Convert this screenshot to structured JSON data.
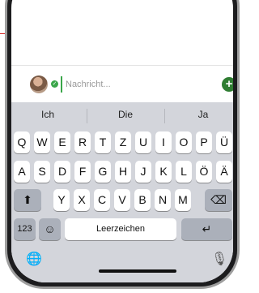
{
  "compose": {
    "placeholder": "Nachricht...",
    "add_button": "+",
    "verified_mark": "✓"
  },
  "keyboard": {
    "suggestions": [
      "Ich",
      "Die",
      "Ja"
    ],
    "row1": [
      "Q",
      "W",
      "E",
      "R",
      "T",
      "Z",
      "U",
      "I",
      "O",
      "P",
      "Ü"
    ],
    "row2": [
      "A",
      "S",
      "D",
      "F",
      "G",
      "H",
      "J",
      "K",
      "L",
      "Ö",
      "Ä"
    ],
    "row3": [
      "Y",
      "X",
      "C",
      "V",
      "B",
      "N",
      "M"
    ],
    "shift_glyph": "⬆",
    "backspace_glyph": "⌫",
    "numbers_label": "123",
    "emoji_glyph": "☺",
    "space_label": "Leerzeichen",
    "return_glyph": "↵",
    "globe_glyph": "🌐",
    "mic_glyph": "🎙"
  },
  "colors": {
    "annotation": "#d62828",
    "accent_green": "#2f7d32",
    "keyboard_bg": "#d3d5db"
  }
}
